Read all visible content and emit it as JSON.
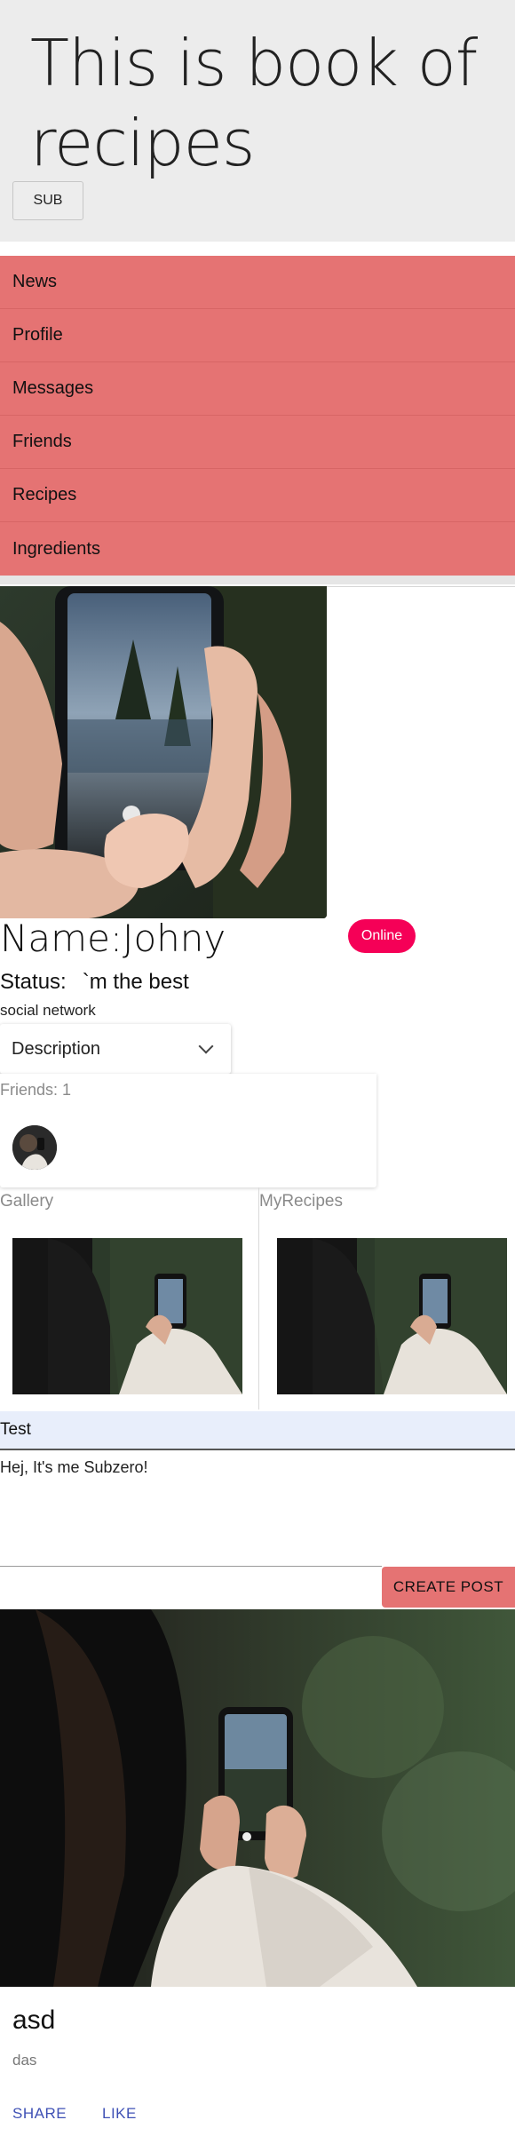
{
  "header": {
    "title": "This is book of recipes",
    "sub_button": "SUB"
  },
  "nav": {
    "items": [
      "News",
      "Profile",
      "Messages",
      "Friends",
      "Recipes",
      "Ingredients"
    ]
  },
  "profile": {
    "name": "Name:Johny",
    "online_badge": "Online",
    "status_label": "Status:",
    "status_value": "`m the best",
    "network": "social network",
    "description_select": "Description",
    "friends_label": "Friends: 1"
  },
  "sections": {
    "gallery_label": "Gallery",
    "myrecipes_label": "MyRecipes"
  },
  "posts_input": {
    "test_label": "Test",
    "post_text": "Hej, It's me Subzero!",
    "create_button": "CREATE POST"
  },
  "post_card": {
    "title": "asd",
    "subtitle": "das",
    "share_label": "SHARE",
    "like_label": "LIKE"
  },
  "colors": {
    "nav_bg": "#e57373",
    "online_badge": "#f50057",
    "action_text": "#3f51b5",
    "test_bar_bg": "#e8eefb"
  }
}
